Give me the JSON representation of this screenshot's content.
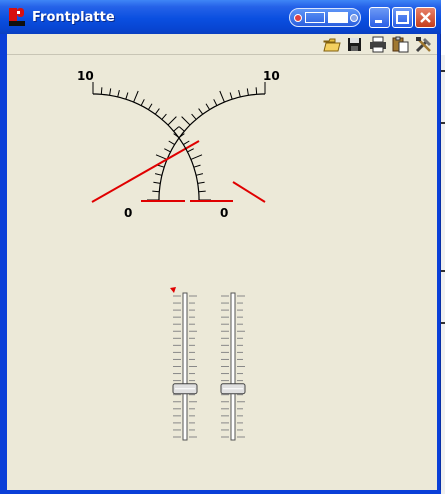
{
  "window": {
    "title": "Frontplatte"
  },
  "toolbar": {
    "buttons": [
      {
        "name": "open-folder-icon"
      },
      {
        "name": "save-disk-icon"
      },
      {
        "name": "print-icon"
      },
      {
        "name": "paste-clipboard-icon"
      },
      {
        "name": "tools-icon"
      }
    ]
  },
  "gauges": {
    "left": {
      "min_label": "0",
      "max_label": "10",
      "needle_color": "#e00000"
    },
    "right": {
      "min_label": "0",
      "max_label": "10",
      "needle_color": "#e00000"
    }
  },
  "sliders": [
    {
      "name": "slider-left",
      "value_fraction": 0.33
    },
    {
      "name": "slider-right",
      "value_fraction": 0.33
    }
  ],
  "colors": {
    "titlebar": "#0a4fe0",
    "panel": "#ece9d8",
    "needle": "#e00000"
  }
}
